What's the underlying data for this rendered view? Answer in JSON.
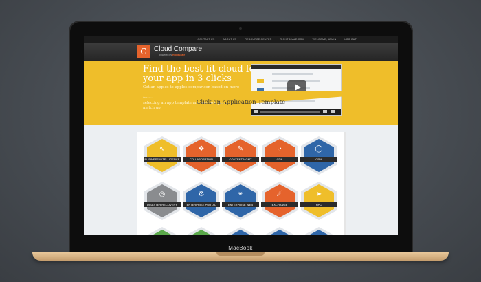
{
  "device_label": "MacBook",
  "nav_links": [
    "CONTACT US",
    "ABOUT US",
    "RESOURCE CENTER",
    "RIGHTSCALE.COM",
    "WELCOME, ADMIN",
    "LOG OUT"
  ],
  "header": {
    "logo_glyph": "G",
    "title": "Cloud Compare",
    "powered_prefix": "powered by",
    "powered_brand": "RightScale"
  },
  "hero": {
    "headline": "Find the best-fit cloud for your app in 3 clicks",
    "body": "Get an apples-to-apples comparison based on more than just price — watch the video to learn about key factors like coverage and performance. Get started by selecting an app template and see how providers match up."
  },
  "section_title": "Click an Application Template",
  "colors": {
    "orange": "#e5632c",
    "yellow": "#efbe2a",
    "blue": "#2f66a8",
    "gray": "#8a8c8f",
    "green": "#5aa84a"
  },
  "templates": [
    {
      "label": "BUSINESS INTELLIGENCE",
      "color": "#efbe2a",
      "icon": "trend-line-icon",
      "glyph": "∿"
    },
    {
      "label": "COLLABORATION",
      "color": "#e5632c",
      "icon": "network-icon",
      "glyph": "❖"
    },
    {
      "label": "CONTENT MGMT",
      "color": "#e5632c",
      "icon": "pencil-icon",
      "glyph": "✎"
    },
    {
      "label": "CDN",
      "color": "#e5632c",
      "icon": "gauge-icon",
      "glyph": "◔"
    },
    {
      "label": "CRM",
      "color": "#2f66a8",
      "icon": "chat-icon",
      "glyph": "◯"
    },
    {
      "label": "DISASTER RECOVERY",
      "color": "#8a8c8f",
      "icon": "life-ring-icon",
      "glyph": "◎"
    },
    {
      "label": "ENTERPRISE PORTAL",
      "color": "#2f66a8",
      "icon": "gear-icon",
      "glyph": "⚙"
    },
    {
      "label": "ENTERPRISE WEB",
      "color": "#2f66a8",
      "icon": "nodes-icon",
      "glyph": "✴"
    },
    {
      "label": "EXCHANGE",
      "color": "#e5632c",
      "icon": "satellite-icon",
      "glyph": "☄"
    },
    {
      "label": "HPC",
      "color": "#efbe2a",
      "icon": "rocket-icon",
      "glyph": "➤"
    }
  ],
  "partial_row_colors": [
    "#5aa84a",
    "#5aa84a",
    "#2f66a8",
    "#2f66a8",
    "#2f66a8"
  ]
}
